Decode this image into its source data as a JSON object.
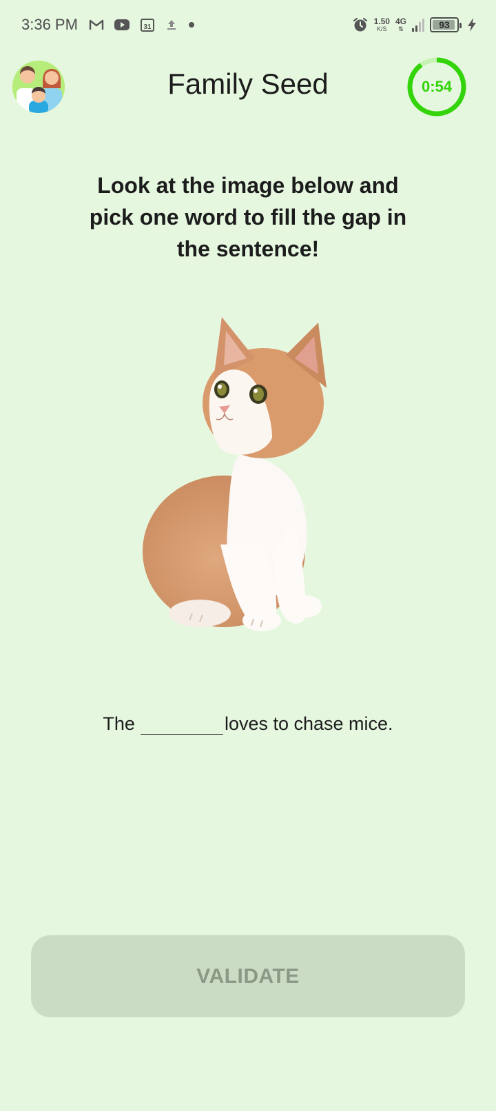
{
  "status_bar": {
    "time": "3:36 PM",
    "icons_left": [
      "gmail-icon",
      "youtube-icon",
      "calendar-icon",
      "upload-icon",
      "dot-icon"
    ],
    "calendar_day": "31",
    "net_speed": "1.50",
    "net_speed_unit": "K/S",
    "network_type": "4G",
    "battery": "93",
    "battery_level": 0.93,
    "icons_right": [
      "alarm-icon",
      "signal-icon",
      "battery-icon",
      "charging-icon"
    ]
  },
  "header": {
    "title": "Family Seed",
    "timer": "0:54",
    "timer_progress": 0.9,
    "timer_color": "#33d40a",
    "avatar_icon": "family-avatar-icon"
  },
  "main": {
    "instruction": "Look at the image below and pick one word to fill the gap in the sentence!",
    "image_icon": "kitten-image",
    "sentence_before": "The",
    "sentence_after": "loves to chase mice."
  },
  "actions": {
    "validate_label": "VALIDATE"
  },
  "colors": {
    "background": "#e6f7e0",
    "accent": "#33d40a",
    "button_disabled": "#cbdcc4"
  }
}
